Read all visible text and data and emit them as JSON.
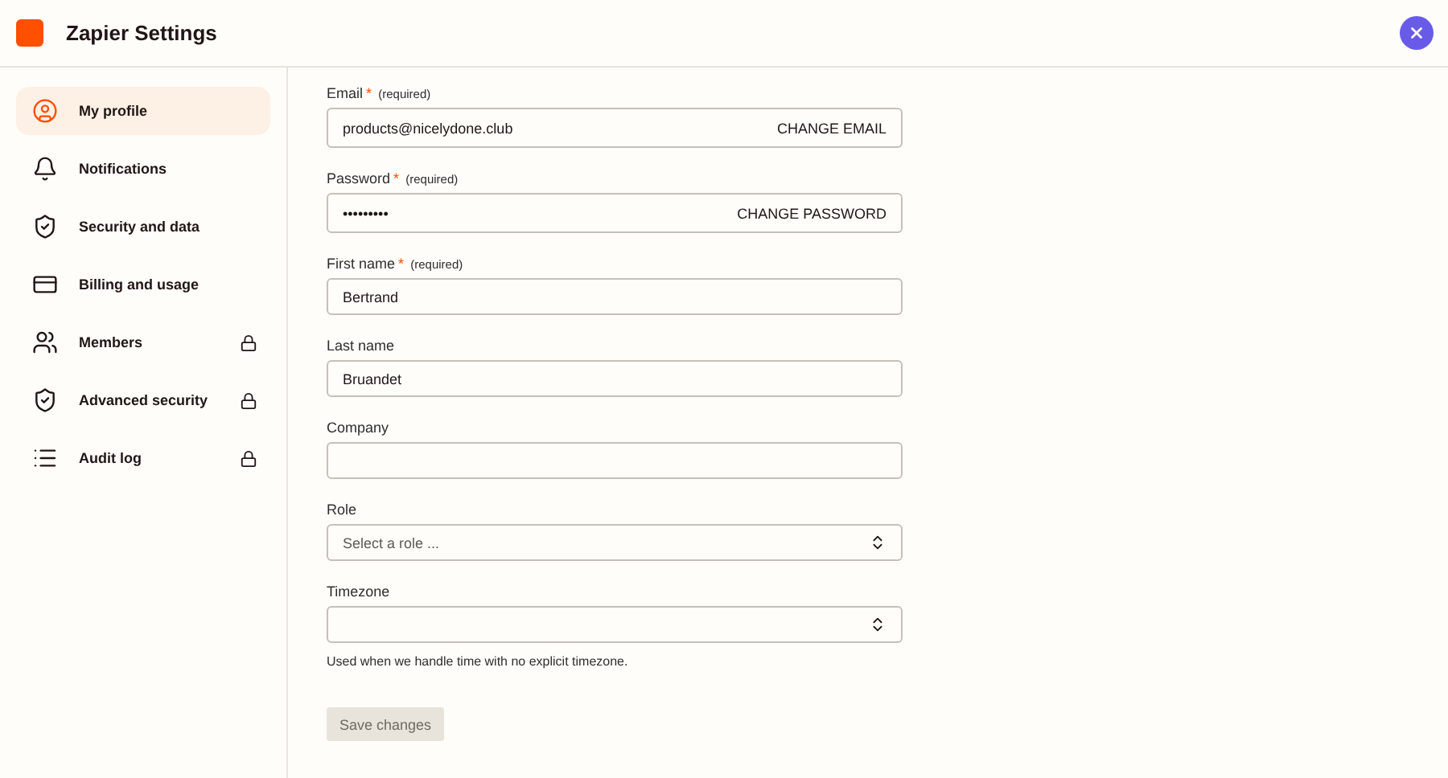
{
  "header": {
    "title": "Zapier Settings"
  },
  "sidebar": {
    "items": [
      {
        "label": "My profile",
        "selected": true,
        "locked": false
      },
      {
        "label": "Notifications",
        "selected": false,
        "locked": false
      },
      {
        "label": "Security and data",
        "selected": false,
        "locked": false
      },
      {
        "label": "Billing and usage",
        "selected": false,
        "locked": false
      },
      {
        "label": "Members",
        "selected": false,
        "locked": true
      },
      {
        "label": "Advanced security",
        "selected": false,
        "locked": true
      },
      {
        "label": "Audit log",
        "selected": false,
        "locked": true
      }
    ]
  },
  "form": {
    "fields": [
      {
        "kind": "text",
        "label": "Email",
        "required_mark": "*",
        "required_note": "(required)",
        "value": "products@nicelydone.club",
        "action": "CHANGE EMAIL"
      },
      {
        "kind": "text",
        "label": "Password",
        "required_mark": "*",
        "required_note": "(required)",
        "value": "•••••••••",
        "action": "CHANGE PASSWORD"
      },
      {
        "kind": "text",
        "label": "First name",
        "required_mark": "*",
        "required_note": "(required)",
        "value": "Bertrand"
      },
      {
        "kind": "text",
        "label": "Last name",
        "value": "Bruandet"
      },
      {
        "kind": "text",
        "label": "Company"
      },
      {
        "kind": "select",
        "label": "Role",
        "placeholder": "Select a role ..."
      },
      {
        "kind": "select",
        "label": "Timezone",
        "help": "Used when we handle time with no explicit timezone."
      }
    ],
    "save_button": {
      "label": "Save changes",
      "disabled": true
    }
  }
}
